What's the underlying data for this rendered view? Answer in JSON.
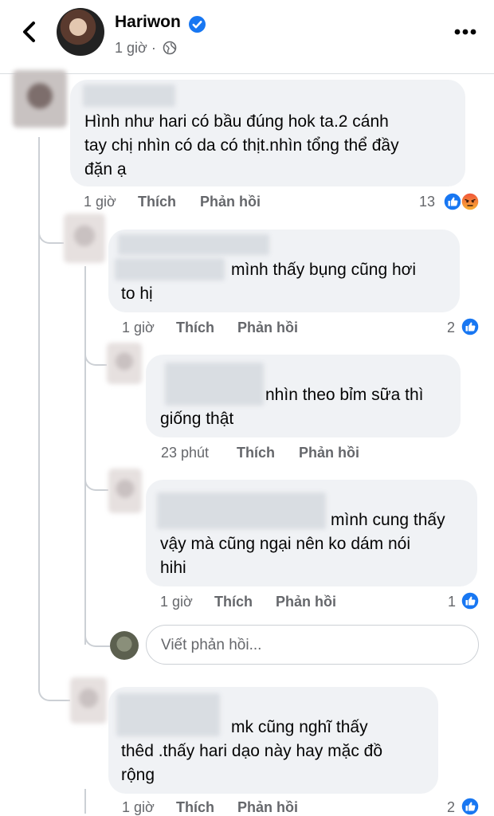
{
  "header": {
    "back_icon": "chevron-left-icon",
    "author": "Hariwon",
    "time": "1 giờ ·",
    "verified_icon": "verified-badge-icon",
    "privacy_icon": "globe-icon",
    "more_icon": "more-horizontal-icon"
  },
  "comments": [
    {
      "text_lines": [
        "Hình như hari có bầu đúng hok ta.2 cánh",
        "tay chị nhìn có da có thịt.nhìn tổng thể đầy",
        "đặn ạ"
      ],
      "time": "1 giờ",
      "like": "Thích",
      "reply": "Phản hồi",
      "reaction_count": "13",
      "reactions": [
        "like-reaction-icon",
        "angry-reaction-icon"
      ]
    },
    {
      "text_lines": [
        "mình thấy bụng cũng hơi",
        "to hị"
      ],
      "time": "1 giờ",
      "like": "Thích",
      "reply": "Phản hồi",
      "reaction_count": "2",
      "reactions": [
        "like-reaction-icon"
      ]
    },
    {
      "text_lines": [
        "nhìn theo bỉm sữa thì",
        "giống thật"
      ],
      "time": "23 phút",
      "like": "Thích",
      "reply": "Phản hồi"
    },
    {
      "text_lines": [
        "mình cung thấy",
        "vậy mà cũng ngại nên ko dám nói",
        "hihi"
      ],
      "time": "1 giờ",
      "like": "Thích",
      "reply": "Phản hồi",
      "reaction_count": "1",
      "reactions": [
        "like-reaction-icon"
      ]
    },
    {
      "text_lines": [
        "mk cũng nghĩ thấy",
        "thêd .thấy hari dạo này hay mặc đồ",
        "rộng"
      ],
      "time": "1 giờ",
      "like": "Thích",
      "reply": "Phản hồi",
      "reaction_count": "2",
      "reactions": [
        "like-reaction-icon"
      ]
    }
  ],
  "reply_box": {
    "placeholder": "Viết phản hồi..."
  },
  "colors": {
    "like_blue": "#1877f2",
    "angry_orange": "#f0533b",
    "bubble_gray": "#f0f2f5",
    "meta_gray": "#65676b"
  }
}
